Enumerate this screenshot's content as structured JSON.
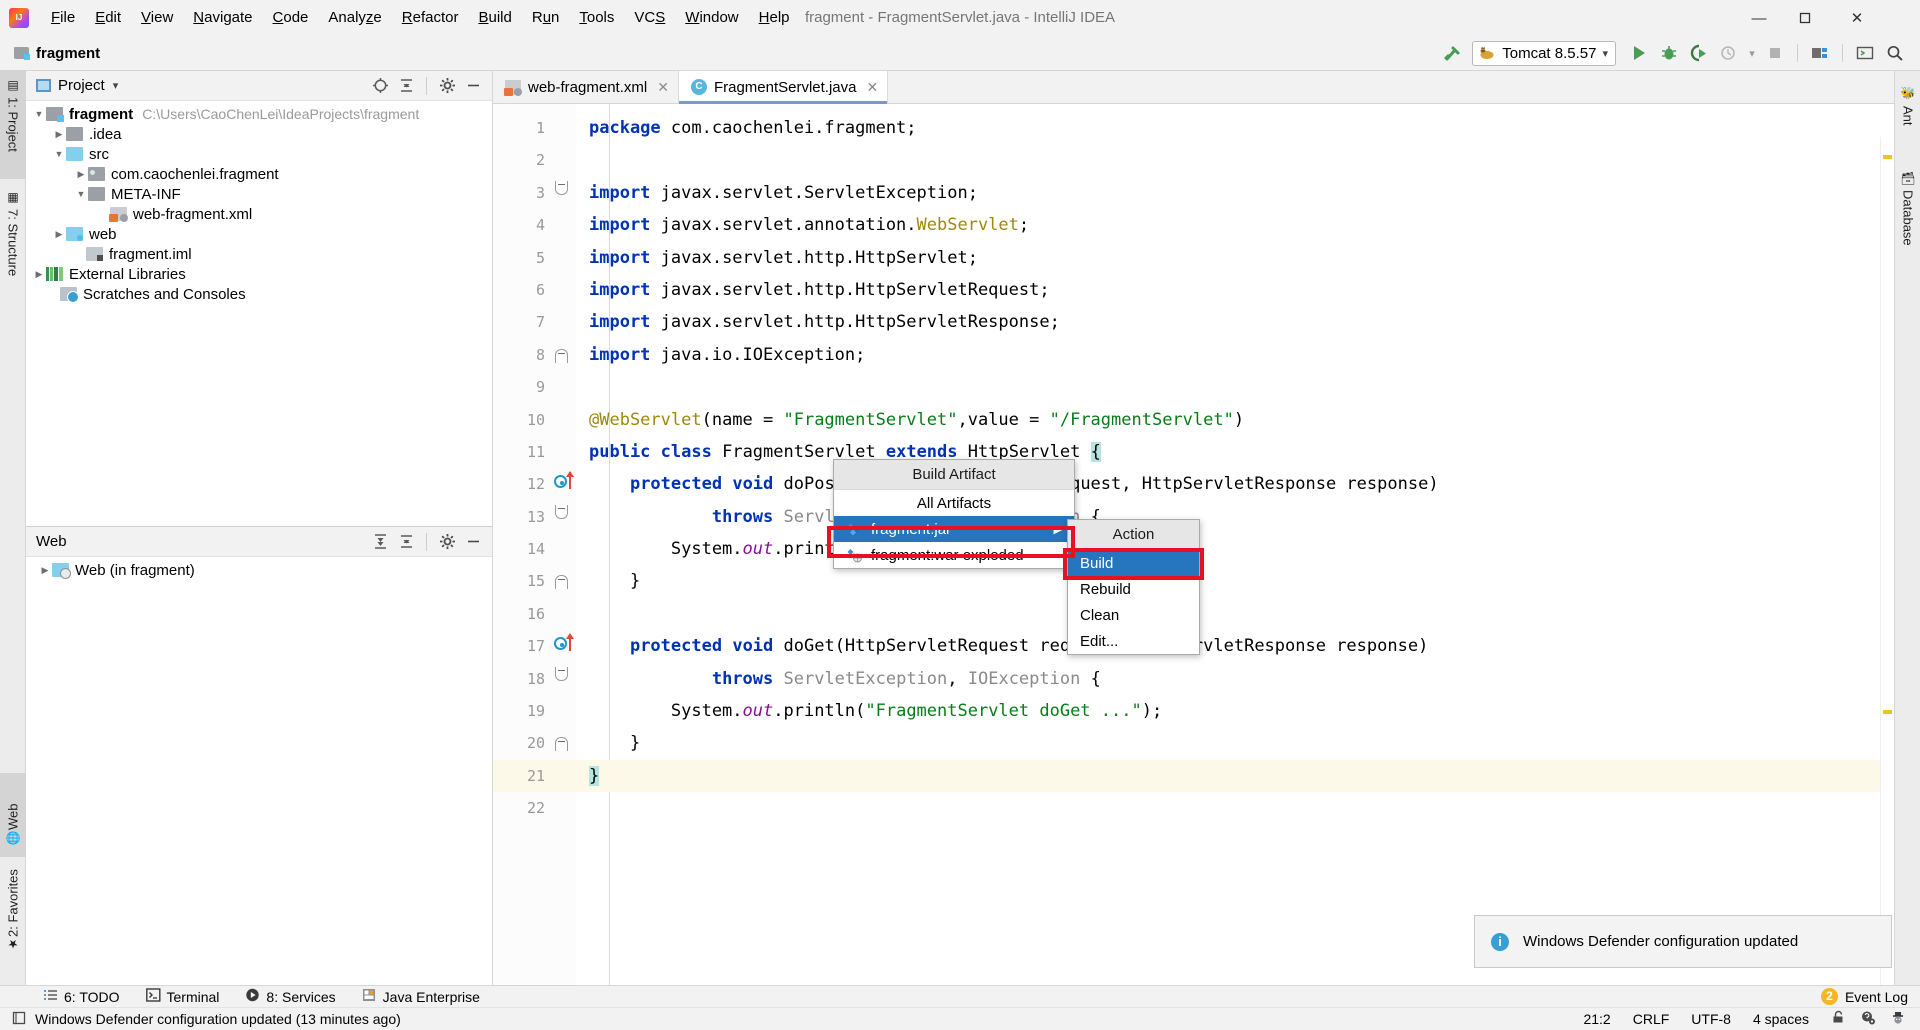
{
  "window": {
    "title": "fragment - FragmentServlet.java - IntelliJ IDEA",
    "logo_label": "IJ",
    "minimize": "—",
    "maximize": "☐",
    "close": "✕"
  },
  "menubar": {
    "items": [
      {
        "label": "File"
      },
      {
        "label": "Edit"
      },
      {
        "label": "View"
      },
      {
        "label": "Navigate"
      },
      {
        "label": "Code"
      },
      {
        "label": "Analyze"
      },
      {
        "label": "Refactor"
      },
      {
        "label": "Build"
      },
      {
        "label": "Run"
      },
      {
        "label": "Tools"
      },
      {
        "label": "VCS"
      },
      {
        "label": "Window"
      },
      {
        "label": "Help"
      }
    ]
  },
  "toolbar": {
    "breadcrumb": "fragment",
    "run_config": "Tomcat 8.5.57",
    "dropdown_caret": "▾",
    "icons": {
      "build_hammer": "build-hammer",
      "run": "▶",
      "debug": "debug",
      "run_coverage": "coverage",
      "profile": "profile",
      "stop": "■",
      "project_structure": "project-structure",
      "terminal_like": "terminal",
      "search_everywhere": "search"
    }
  },
  "left_strip": {
    "top": [
      {
        "label": "1: Project",
        "selected": true
      },
      {
        "label": "7: Structure",
        "selected": false
      }
    ],
    "bottom": [
      {
        "label": "Web",
        "selected": true
      },
      {
        "label": "2: Favorites",
        "selected": false
      }
    ]
  },
  "right_strip": {
    "items": [
      {
        "label": "Ant"
      },
      {
        "label": "Database"
      }
    ]
  },
  "project_panel": {
    "title": "Project",
    "caret": "▾",
    "toolbar_icons": [
      "locate-icon",
      "collapse-all-icon",
      "gear-icon",
      "hide-icon"
    ],
    "tree": [
      {
        "label": "fragment",
        "path": "C:\\Users\\CaoChenLei\\IdeaProjects\\fragment",
        "indent": 0,
        "arrow": "▼",
        "icon": "module-folder-icon",
        "bold": true
      },
      {
        "label": ".idea",
        "path": "",
        "indent": 1,
        "arrow": "▶",
        "icon": "folder-icon",
        "bold": false
      },
      {
        "label": "src",
        "path": "",
        "indent": 1,
        "arrow": "▼",
        "icon": "source-folder-icon",
        "bold": false
      },
      {
        "label": "com.caochenlei.fragment",
        "path": "",
        "indent": 2,
        "arrow": "▶",
        "icon": "package-icon",
        "bold": false
      },
      {
        "label": "META-INF",
        "path": "",
        "indent": 2,
        "arrow": "▼",
        "icon": "folder-icon",
        "bold": false
      },
      {
        "label": "web-fragment.xml",
        "path": "",
        "indent": 3,
        "arrow": "",
        "icon": "xml-file-icon",
        "bold": false
      },
      {
        "label": "web",
        "path": "",
        "indent": 1,
        "arrow": "▶",
        "icon": "web-folder-icon",
        "bold": false
      },
      {
        "label": "fragment.iml",
        "path": "",
        "indent": 1,
        "arrow": "",
        "icon": "iml-file-icon",
        "bold": false
      },
      {
        "label": "External Libraries",
        "path": "",
        "indent": 0,
        "arrow": "▶",
        "icon": "libraries-icon",
        "bold": false
      },
      {
        "label": "Scratches and Consoles",
        "path": "",
        "indent": 0,
        "arrow": "",
        "icon": "scratches-icon",
        "bold": false
      }
    ]
  },
  "web_panel": {
    "title": "Web",
    "toolbar_icons": [
      "expand-all-icon",
      "collapse-all-icon",
      "gear-icon",
      "hide-icon"
    ],
    "tree": [
      {
        "label": "Web (in fragment)",
        "arrow": "▶",
        "icon": "web-facet-icon"
      }
    ]
  },
  "editor": {
    "tabs": [
      {
        "label": "web-fragment.xml",
        "icon": "xml-file-icon",
        "active": false,
        "close": "✕"
      },
      {
        "label": "FragmentServlet.java",
        "icon": "java-class-icon",
        "active": true,
        "close": "✕"
      }
    ],
    "lines": [
      {
        "n": "1",
        "html": "<span class='kw'>package</span> com.caochenlei.fragment;",
        "gutter": "",
        "current": false
      },
      {
        "n": "2",
        "html": "",
        "gutter": "",
        "current": false
      },
      {
        "n": "3",
        "html": "<span class='kw'>import</span> javax.servlet.ServletException;",
        "gutter": "fold-down",
        "current": false
      },
      {
        "n": "4",
        "html": "<span class='kw'>import</span> javax.servlet.annotation.<span class='ann'>WebServlet</span>;",
        "gutter": "",
        "current": false
      },
      {
        "n": "5",
        "html": "<span class='kw'>import</span> javax.servlet.http.HttpServlet;",
        "gutter": "",
        "current": false
      },
      {
        "n": "6",
        "html": "<span class='kw'>import</span> javax.servlet.http.HttpServletRequest;",
        "gutter": "",
        "current": false
      },
      {
        "n": "7",
        "html": "<span class='kw'>import</span> javax.servlet.http.HttpServletResponse;",
        "gutter": "",
        "current": false
      },
      {
        "n": "8",
        "html": "<span class='kw'>import</span> java.io.IOException;",
        "gutter": "fold-up",
        "current": false
      },
      {
        "n": "9",
        "html": "",
        "gutter": "",
        "current": false
      },
      {
        "n": "10",
        "html": "<span class='ann'>@WebServlet</span>(name = <span class='str'>\"FragmentServlet\"</span>,value = <span class='str'>\"/FragmentServlet\"</span>)",
        "gutter": "",
        "current": false
      },
      {
        "n": "11",
        "html": "<span class='kw'>public</span> <span class='kw'>class</span> FragmentServlet <span class='kw'>extends</span> HttpServlet <span class='cursor-hl'>{</span>",
        "gutter": "",
        "current": false
      },
      {
        "n": "12",
        "html": "    <span class='kw'>protected</span> <span class='kw'>void</span> <span class='cls'>doPost</span>(HttpServletRequest request, HttpServletResponse response)",
        "gutter": "override",
        "current": false
      },
      {
        "n": "13",
        "html": "            <span class='kw'>throws</span> <span class='type-gray'>ServletException</span>, <span class='type-gray'>IOException</span> {",
        "gutter": "fold-down",
        "current": false
      },
      {
        "n": "14",
        "html": "        System.<span class='fld'>out</span>.println(<span class='str'>\"FragmentServlet doPost ...\"</span>);",
        "gutter": "",
        "current": false
      },
      {
        "n": "15",
        "html": "    }",
        "gutter": "fold-up",
        "current": false
      },
      {
        "n": "16",
        "html": "",
        "gutter": "",
        "current": false
      },
      {
        "n": "17",
        "html": "    <span class='kw'>protected</span> <span class='kw'>void</span> <span class='cls'>doGet</span>(HttpServletRequest request, HttpServletResponse response)",
        "gutter": "override",
        "current": false
      },
      {
        "n": "18",
        "html": "            <span class='kw'>throws</span> <span class='type-gray'>ServletException</span>, <span class='type-gray'>IOException</span> {",
        "gutter": "fold-down",
        "current": false
      },
      {
        "n": "19",
        "html": "        System.<span class='fld'>out</span>.println(<span class='str'>\"FragmentServlet doGet ...\"</span>);",
        "gutter": "",
        "current": false
      },
      {
        "n": "20",
        "html": "    }",
        "gutter": "fold-up",
        "current": false
      },
      {
        "n": "21",
        "html": "<span class='cursor-hl'>}</span>",
        "gutter": "",
        "current": true
      },
      {
        "n": "22",
        "html": "",
        "gutter": "",
        "current": false
      }
    ]
  },
  "popup_build_artifact": {
    "title": "Build Artifact",
    "items": [
      {
        "label": "All Artifacts",
        "icon": "",
        "selected": false,
        "submenu": false
      },
      {
        "label": "fragment:jar",
        "icon": "jar-artifact-icon",
        "selected": true,
        "submenu": true,
        "arrow": "▶"
      },
      {
        "label": "fragment:war exploded",
        "icon": "war-exploded-artifact-icon",
        "selected": false,
        "submenu": false
      }
    ]
  },
  "popup_action": {
    "title": "Action",
    "items": [
      {
        "label": "Build",
        "selected": true
      },
      {
        "label": "Rebuild",
        "selected": false
      },
      {
        "label": "Clean",
        "selected": false
      },
      {
        "label": "Edit...",
        "selected": false
      }
    ]
  },
  "notification": {
    "text": "Windows Defender configuration updated",
    "icon": "info-icon",
    "icon_glyph": "i"
  },
  "bottom_tools": {
    "items": [
      {
        "label": "6: TODO",
        "icon": "todo-icon"
      },
      {
        "label": "Terminal",
        "icon": "terminal-icon"
      },
      {
        "label": "8: Services",
        "icon": "services-icon"
      },
      {
        "label": "Java Enterprise",
        "icon": "java-enterprise-icon"
      }
    ],
    "event_log": {
      "label": "Event Log",
      "count": "2"
    }
  },
  "statusbar": {
    "message": "Windows Defender configuration updated (13 minutes ago)",
    "message_icon": "notification-icon",
    "caret_position": "21:2",
    "line_separator": "CRLF",
    "encoding": "UTF-8",
    "indent": "4 spaces",
    "icons": [
      "lock-icon",
      "inspections-icon",
      "hector-icon"
    ]
  },
  "colors": {
    "accent_blue": "#2675bf",
    "highlight_red": "#e81123",
    "keyword_blue": "#0033b3",
    "string_green": "#067d17",
    "annotation_gold": "#9e880d",
    "field_purple": "#871094",
    "caret_line": "#fdf9e8",
    "selection_cyan": "#b7e3e0",
    "chrome_gray": "#f2f2f2"
  }
}
